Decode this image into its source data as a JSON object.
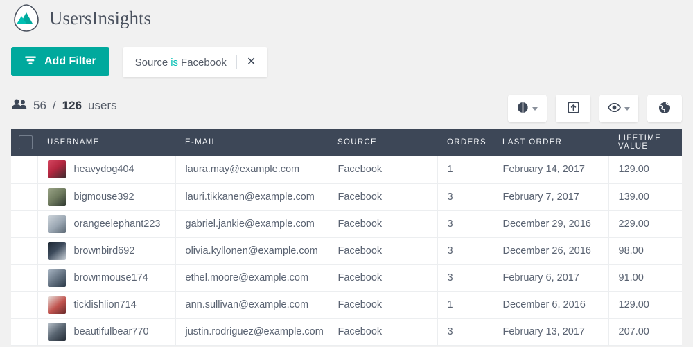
{
  "brand": {
    "name": "UsersInsights",
    "logo_icon": "mountain-logo-icon",
    "accent": "#00a99d"
  },
  "filters": {
    "add_label": "Add Filter",
    "add_icon": "funnel-icon",
    "chip": {
      "field": "Source",
      "operator": "is",
      "value": "Facebook",
      "remove_icon": "close-icon"
    }
  },
  "stats": {
    "icon": "users-icon",
    "shown": "56",
    "separator": "/",
    "total": "126",
    "suffix": "users"
  },
  "toolbar": [
    {
      "name": "charts-button",
      "icon": "pie-chart-icon",
      "has_caret": true
    },
    {
      "name": "export-button",
      "icon": "export-box-icon",
      "has_caret": false
    },
    {
      "name": "visibility-button",
      "icon": "eye-icon",
      "has_caret": true
    },
    {
      "name": "map-button",
      "icon": "globe-icon",
      "has_caret": false
    }
  ],
  "table": {
    "select_all_icon": "checkbox-icon",
    "columns": [
      "USERNAME",
      "E-MAIL",
      "SOURCE",
      "ORDERS",
      "LAST ORDER",
      "LIFETIME VALUE"
    ],
    "rows": [
      {
        "avatar": "avatar-1",
        "username": "heavydog404",
        "email": "laura.may@example.com",
        "source": "Facebook",
        "orders": "1",
        "last_order": "February 14, 2017",
        "lifetime_value": "129.00"
      },
      {
        "avatar": "avatar-2",
        "username": "bigmouse392",
        "email": "lauri.tikkanen@example.com",
        "source": "Facebook",
        "orders": "3",
        "last_order": "February 7, 2017",
        "lifetime_value": "139.00"
      },
      {
        "avatar": "avatar-3",
        "username": "orangeelephant223",
        "email": "gabriel.jankie@example.com",
        "source": "Facebook",
        "orders": "3",
        "last_order": "December 29, 2016",
        "lifetime_value": "229.00"
      },
      {
        "avatar": "avatar-4",
        "username": "brownbird692",
        "email": "olivia.kyllonen@example.com",
        "source": "Facebook",
        "orders": "3",
        "last_order": "December 26, 2016",
        "lifetime_value": "98.00"
      },
      {
        "avatar": "avatar-5",
        "username": "brownmouse174",
        "email": "ethel.moore@example.com",
        "source": "Facebook",
        "orders": "3",
        "last_order": "February 6, 2017",
        "lifetime_value": "91.00"
      },
      {
        "avatar": "avatar-6",
        "username": "ticklishlion714",
        "email": "ann.sullivan@example.com",
        "source": "Facebook",
        "orders": "1",
        "last_order": "December 6, 2016",
        "lifetime_value": "129.00"
      },
      {
        "avatar": "avatar-7",
        "username": "beautifulbear770",
        "email": "justin.rodriguez@example.com",
        "source": "Facebook",
        "orders": "3",
        "last_order": "February 13, 2017",
        "lifetime_value": "207.00"
      }
    ]
  }
}
